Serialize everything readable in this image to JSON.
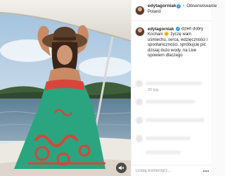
{
  "post": {
    "username": "edytagorniak",
    "verified_mark": "✓",
    "separator": "•",
    "follow_label": "Obserwowanie",
    "location": "Poland",
    "caption": "dzień dobry Kochani 🌞 życzę wam uśmiechu, serca, wdzięczności i spontaniczności. spróbujcie pić dzisiaj dużo wody. na Live opowiem dlaczego",
    "timestamp": "20 tyg.",
    "comment_placeholder": "Dodaj komentarz..."
  },
  "icons": {
    "mute": "speaker-muted-icon",
    "more": "more-options-icon",
    "verified": "verified-badge-icon"
  },
  "colors": {
    "accent_blue": "#3897f0",
    "dress_teal": "#2aa57f",
    "dress_red": "#d8453a"
  }
}
